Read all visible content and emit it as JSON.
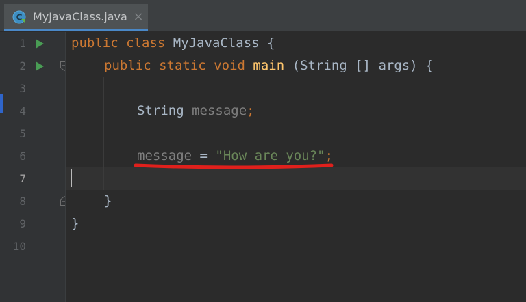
{
  "tab": {
    "icon": "java-class-icon",
    "title": "MyJavaClass.java",
    "close_glyph": "×"
  },
  "gutter": {
    "line_numbers": [
      "1",
      "2",
      "3",
      "4",
      "5",
      "6",
      "7",
      "8",
      "9",
      "10"
    ],
    "active_line": "7"
  },
  "code": {
    "line1": {
      "kw1": "public",
      "kw2": "class",
      "name": "MyJavaClass",
      "brace": "{"
    },
    "line2": {
      "kw1": "public",
      "kw2": "static",
      "kw3": "void",
      "fn": "main",
      "params": "(String [] args) {"
    },
    "line4": {
      "type": "String",
      "var": "message",
      "semi": ";"
    },
    "line6": {
      "var": "message",
      "op": " = ",
      "str": "\"How are you?\"",
      "semi": ";"
    },
    "line8": {
      "brace": "}"
    },
    "line9": {
      "brace": "}"
    }
  },
  "colors": {
    "keyword": "#cc7832",
    "function": "#ffc66d",
    "string": "#6a8759",
    "unused": "#7f7f7f",
    "annotation_underline": "#e0201c"
  }
}
